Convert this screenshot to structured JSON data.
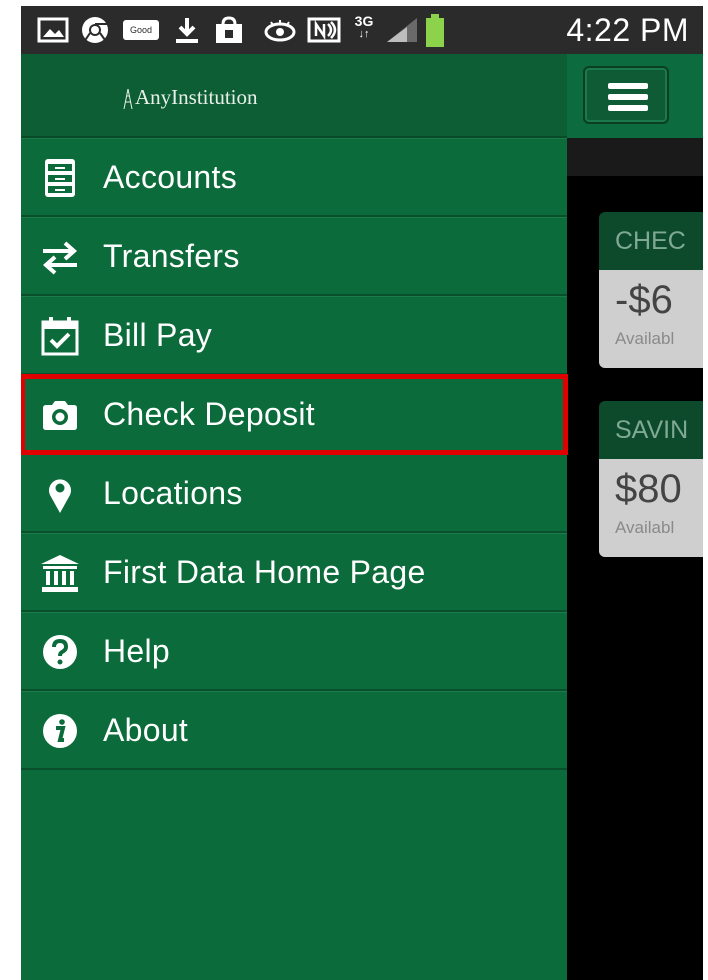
{
  "status_bar": {
    "time": "4:22 PM",
    "network_label": "3G",
    "icons": [
      "image-icon",
      "chrome-icon",
      "good-app-icon",
      "download-icon",
      "shopping-bag-icon",
      "eye-icon",
      "nfc-icon",
      "network-3g-icon",
      "signal-icon",
      "battery-icon"
    ],
    "good_label": "Good"
  },
  "drawer": {
    "logo_text": "AnyInstitution",
    "items": [
      {
        "label": "Accounts",
        "icon": "file-cabinet-icon"
      },
      {
        "label": "Transfers",
        "icon": "transfer-arrows-icon"
      },
      {
        "label": "Bill Pay",
        "icon": "calendar-check-icon"
      },
      {
        "label": "Check Deposit",
        "icon": "camera-icon",
        "highlighted": true
      },
      {
        "label": "Locations",
        "icon": "map-pin-icon"
      },
      {
        "label": "First Data Home Page",
        "icon": "bank-icon"
      },
      {
        "label": "Help",
        "icon": "help-icon"
      },
      {
        "label": "About",
        "icon": "info-icon"
      }
    ]
  },
  "background": {
    "accounts": [
      {
        "name": "CHEC",
        "amount": "-$6",
        "available": "Availabl"
      },
      {
        "name": "SAVIN",
        "amount": "$80",
        "available": "Availabl"
      }
    ]
  },
  "colors": {
    "drawer_bg": "#0b6b3a",
    "highlight": "#e10000",
    "status_bar": "#2b2b2b"
  }
}
